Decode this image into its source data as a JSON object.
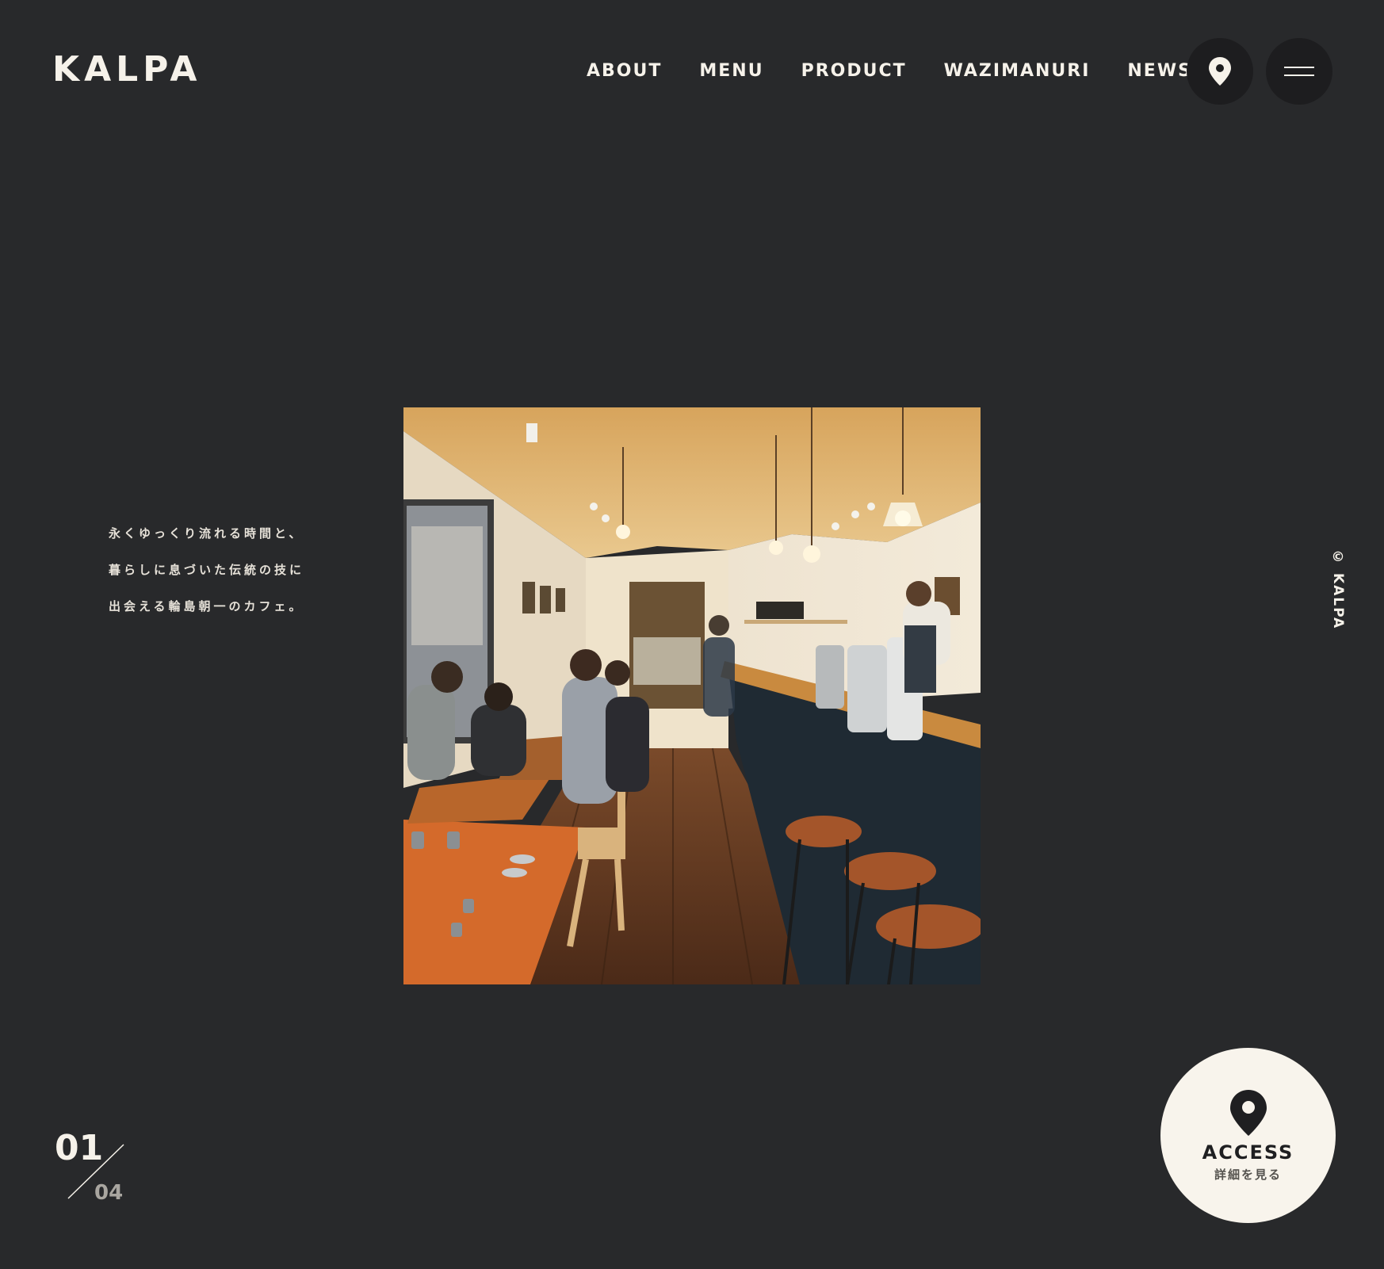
{
  "header": {
    "logo": "KALPA",
    "nav": [
      "ABOUT",
      "MENU",
      "PRODUCT",
      "WAZIMANURI",
      "NEWS"
    ],
    "map_icon": "map-pin-icon",
    "menu_icon": "hamburger-icon"
  },
  "hero": {
    "tagline": [
      "永くゆっくり流れる時間と、",
      "暮らしに息づいた伝統の技に",
      "出会える輪島朝一のカフェ。"
    ],
    "copyright": "© KALPA"
  },
  "slider": {
    "current": "01",
    "total": "04"
  },
  "access": {
    "title": "ACCESS",
    "subtitle": "詳細を見る",
    "icon": "map-pin-icon"
  },
  "colors": {
    "background": "#28292b",
    "text": "#f6f2ea",
    "button_dark": "#1d1d1f",
    "access_bg": "#f8f4ec"
  }
}
